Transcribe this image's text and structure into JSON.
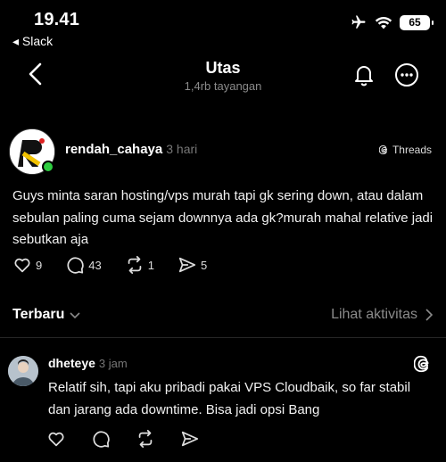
{
  "status": {
    "time": "19.41",
    "back_app": "◂ Slack",
    "battery": "65"
  },
  "nav": {
    "title": "Utas",
    "subtitle": "1,4rb tayangan"
  },
  "post": {
    "username": "rendah_cahaya",
    "time_ago": "3 hari",
    "source": "Threads",
    "text": "Guys minta saran hosting/vps murah tapi gk sering down, atau dalam sebulan paling cuma sejam downnya ada gk?murah mahal relative jadi sebutkan aja",
    "likes": "9",
    "comments": "43",
    "reposts": "1",
    "shares": "5"
  },
  "sort": {
    "label": "Terbaru",
    "activity": "Lihat aktivitas"
  },
  "reply": {
    "username": "dheteye",
    "time_ago": "3 jam",
    "text": "Relatif sih, tapi aku pribadi pakai VPS Cloudbaik, so far stabil dan jarang ada downtime. Bisa jadi opsi Bang"
  },
  "colors": {
    "background": "#000000",
    "online": "#2ecc40",
    "muted": "#8a8a8a"
  }
}
